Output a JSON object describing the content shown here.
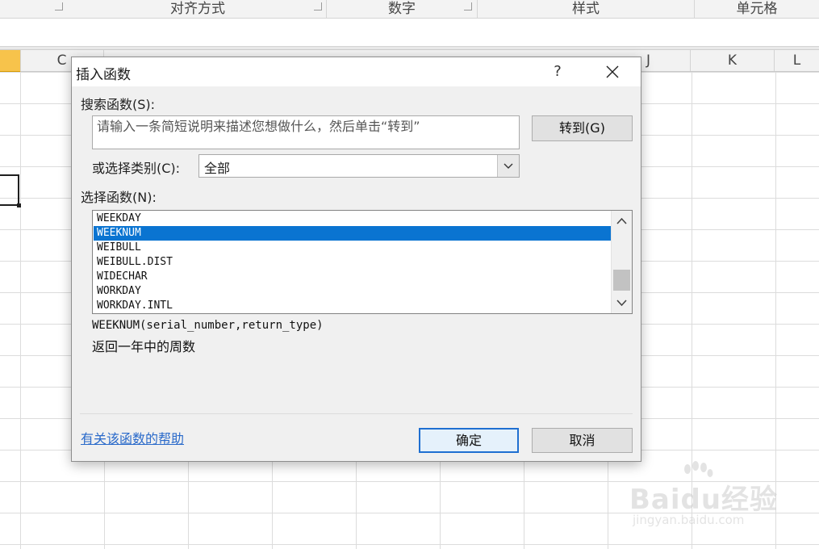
{
  "ribbon": {
    "groups": [
      "对齐方式",
      "数字",
      "样式",
      "单元格"
    ]
  },
  "columns": {
    "visible": [
      "C",
      "J",
      "K",
      "L"
    ]
  },
  "dialog": {
    "title": "插入函数",
    "help_glyph": "?",
    "search_label": "搜索函数(S):",
    "search_placeholder": "请输入一条简短说明来描述您想做什么，然后单击“转到”",
    "goto_label": "转到(G)",
    "category_label": "或选择类别(C):",
    "category_value": "全部",
    "function_list_label": "选择函数(N):",
    "functions": [
      "WEEKDAY",
      "WEEKNUM",
      "WEIBULL",
      "WEIBULL.DIST",
      "WIDECHAR",
      "WORKDAY",
      "WORKDAY.INTL"
    ],
    "selected_function": "WEEKNUM",
    "signature": "WEEKNUM(serial_number,return_type)",
    "description": "返回一年中的周数",
    "help_link": "有关该函数的帮助",
    "ok_label": "确定",
    "cancel_label": "取消"
  },
  "watermark": {
    "main": "Baidu经验",
    "sub": "jingyan.baidu.com"
  },
  "colors": {
    "selection": "#0a74d1",
    "selected_column": "#f7c34b",
    "link": "#2a6aca"
  }
}
